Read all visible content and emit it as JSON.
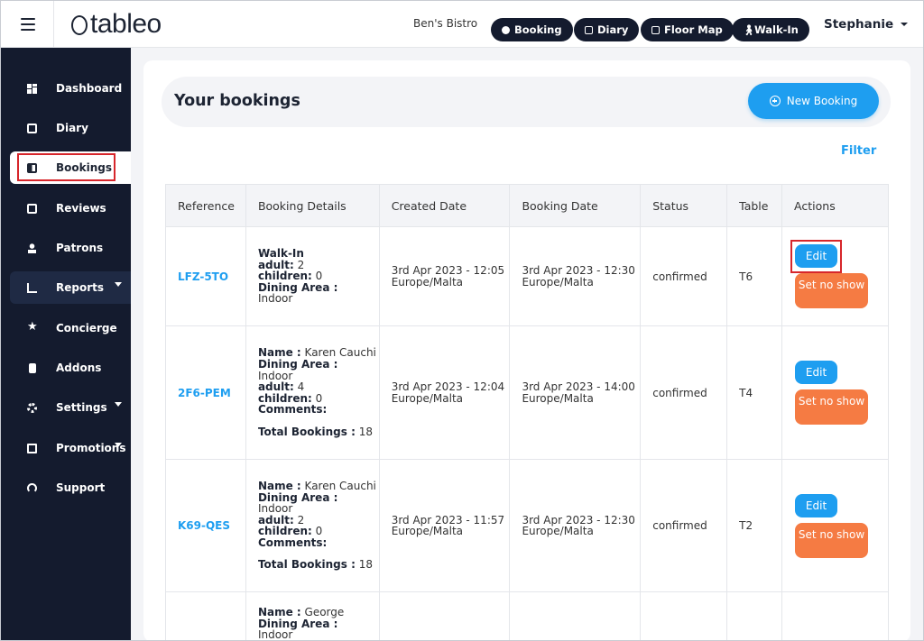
{
  "header": {
    "logo_text": "tableo",
    "venue": "Ben's Bistro",
    "buttons": [
      {
        "label": "Booking",
        "icon": "plus-circle-icon"
      },
      {
        "label": "Diary",
        "icon": "calendar-icon"
      },
      {
        "label": "Floor Map",
        "icon": "floor-map-icon"
      },
      {
        "label": "Walk-In",
        "icon": "walk-icon"
      }
    ],
    "user": "Stephanie"
  },
  "sidebar": {
    "items": [
      {
        "label": "Dashboard",
        "icon": "dashboard-icon"
      },
      {
        "label": "Diary",
        "icon": "calendar-icon"
      },
      {
        "label": "Bookings",
        "icon": "book-icon",
        "active": true
      },
      {
        "label": "Reviews",
        "icon": "review-icon"
      },
      {
        "label": "Patrons",
        "icon": "person-icon"
      },
      {
        "label": "Reports",
        "icon": "chart-icon",
        "has_submenu": true
      },
      {
        "label": "Concierge",
        "icon": "star-icon"
      },
      {
        "label": "Addons",
        "icon": "addon-icon"
      },
      {
        "label": "Settings",
        "icon": "gear-icon",
        "has_submenu": true
      },
      {
        "label": "Promotions",
        "icon": "promotion-icon",
        "has_submenu": true
      },
      {
        "label": "Support",
        "icon": "headset-icon"
      }
    ]
  },
  "main": {
    "title": "Your bookings",
    "new_booking_label": "New Booking",
    "filter_label": "Filter",
    "table": {
      "columns": [
        "Reference",
        "Booking Details",
        "Created Date",
        "Booking Date",
        "Status",
        "Table",
        "Actions"
      ],
      "edit_label": "Edit",
      "no_show_label": "Set no show",
      "rows": [
        {
          "reference": "LFZ-5TO",
          "details": [
            {
              "k": "Walk-In",
              "v": ""
            },
            {
              "k": "adult:",
              "v": "2"
            },
            {
              "k": "children:",
              "v": "0"
            },
            {
              "k": "Dining Area :",
              "v": ""
            },
            {
              "k": "",
              "v": "Indoor"
            }
          ],
          "created": "3rd Apr 2023 - 12:05 Europe/Malta",
          "booking": "3rd Apr 2023 - 12:30 Europe/Malta",
          "status": "confirmed",
          "table": "T6"
        },
        {
          "reference": "2F6-PEM",
          "details": [
            {
              "k": "Name :",
              "v": "Karen Cauchi"
            },
            {
              "k": "Dining Area :",
              "v": ""
            },
            {
              "k": "",
              "v": "Indoor"
            },
            {
              "k": "adult:",
              "v": "4"
            },
            {
              "k": "children:",
              "v": "0"
            },
            {
              "k": "Comments:",
              "v": ""
            },
            {
              "k": "",
              "v": ""
            },
            {
              "k": "Total Bookings :",
              "v": "18"
            }
          ],
          "created": "3rd Apr 2023 - 12:04 Europe/Malta",
          "booking": "3rd Apr 2023 - 14:00 Europe/Malta",
          "status": "confirmed",
          "table": "T4"
        },
        {
          "reference": "K69-QES",
          "details": [
            {
              "k": "Name :",
              "v": "Karen Cauchi"
            },
            {
              "k": "Dining Area :",
              "v": ""
            },
            {
              "k": "",
              "v": "Indoor"
            },
            {
              "k": "adult:",
              "v": "2"
            },
            {
              "k": "children:",
              "v": "0"
            },
            {
              "k": "Comments:",
              "v": ""
            },
            {
              "k": "",
              "v": ""
            },
            {
              "k": "Total Bookings :",
              "v": "18"
            }
          ],
          "created": "3rd Apr 2023 - 11:57 Europe/Malta",
          "booking": "3rd Apr 2023 - 12:30 Europe/Malta",
          "status": "confirmed",
          "table": "T2"
        },
        {
          "reference": "",
          "details": [
            {
              "k": "Name :",
              "v": "George"
            },
            {
              "k": "Dining Area :",
              "v": ""
            },
            {
              "k": "",
              "v": "Indoor"
            }
          ],
          "created": "",
          "booking": "",
          "status": "",
          "table": ""
        }
      ]
    }
  },
  "colors": {
    "sidebar_bg": "#141b2e",
    "accent_blue": "#1e9ef0",
    "no_show_orange": "#f57b43",
    "highlight_red": "#d7262b"
  }
}
